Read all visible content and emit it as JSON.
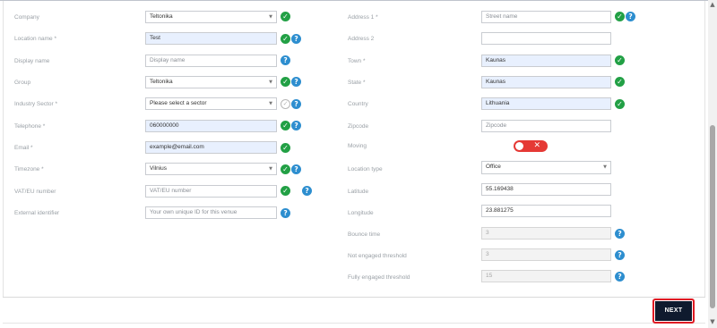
{
  "left_fields": [
    {
      "label": "Company",
      "value": "Teltonika",
      "placeholder": ""
    },
    {
      "label": "Location name *",
      "value": "Test",
      "placeholder": ""
    },
    {
      "label": "Display name",
      "value": "",
      "placeholder": "Display name"
    },
    {
      "label": "Group",
      "value": "Teltonika",
      "placeholder": ""
    },
    {
      "label": "Industry Sector *",
      "value": "Please select a sector",
      "placeholder": ""
    },
    {
      "label": "Telephone *",
      "value": "060000000",
      "placeholder": ""
    },
    {
      "label": "Email *",
      "value": "example@email.com",
      "placeholder": ""
    },
    {
      "label": "Timezone *",
      "value": "Vilnius",
      "placeholder": ""
    },
    {
      "label": "VAT/EU number",
      "value": "",
      "placeholder": "VAT/EU number"
    },
    {
      "label": "External identifier",
      "value": "",
      "placeholder": "Your own unique ID for this venue"
    }
  ],
  "right_fields": [
    {
      "label": "Address 1 *",
      "value": "",
      "placeholder": "Street name"
    },
    {
      "label": "Address 2",
      "value": "",
      "placeholder": ""
    },
    {
      "label": "Town *",
      "value": "Kaunas",
      "placeholder": ""
    },
    {
      "label": "State *",
      "value": "Kaunas",
      "placeholder": ""
    },
    {
      "label": "Country",
      "value": "Lithuania",
      "placeholder": ""
    },
    {
      "label": "Zipcode",
      "value": "",
      "placeholder": "Zipcode"
    },
    {
      "label": "Moving",
      "value": "",
      "placeholder": ""
    },
    {
      "label": "Location type",
      "value": "Office",
      "placeholder": ""
    },
    {
      "label": "Latitude",
      "value": "55.169438",
      "placeholder": ""
    },
    {
      "label": "Longitude",
      "value": "23.881275",
      "placeholder": ""
    },
    {
      "label": "Bounce time",
      "value": "3",
      "placeholder": ""
    },
    {
      "label": "Not engaged threshold",
      "value": "3",
      "placeholder": ""
    },
    {
      "label": "Fully engaged threshold",
      "value": "15",
      "placeholder": ""
    }
  ],
  "moving_toggle": {
    "on": false,
    "symbol": "✕"
  },
  "icons": {
    "check": "✓",
    "help": "?",
    "dropdown": "▼",
    "scroll_up": "▲",
    "scroll_down": "▼"
  },
  "colors": {
    "valid": "#22a045",
    "help": "#2d8ecf",
    "toggle_off": "#e53935",
    "primary_button": "#0f1a2e",
    "highlight": "#e01b24"
  },
  "actions": {
    "next_label": "NEXT"
  }
}
